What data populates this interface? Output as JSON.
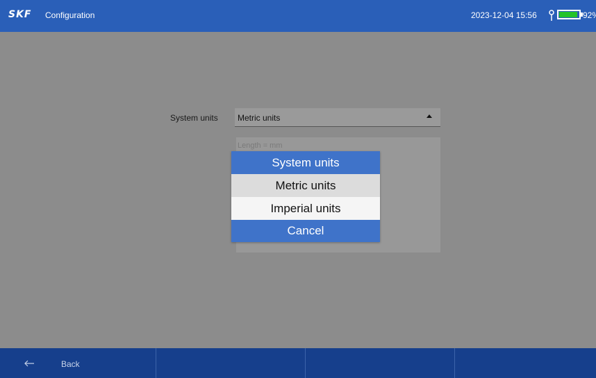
{
  "header": {
    "logo": "SKF",
    "title": "Configuration",
    "datetime": "2023-12-04 15:56",
    "battery_percent_text": "92%",
    "battery_level": 0.92
  },
  "form": {
    "label": "System units",
    "selected_value": "Metric units",
    "info_length": "Length = mm"
  },
  "popup": {
    "title": "System units",
    "options": [
      "Metric units",
      "Imperial units"
    ],
    "cancel": "Cancel"
  },
  "footer": {
    "back_label": "Back"
  },
  "colors": {
    "header_bg": "#2a5fb8",
    "footer_bg": "#163f8c",
    "popup_accent": "#3f73c9",
    "battery_green": "#22c32a"
  }
}
